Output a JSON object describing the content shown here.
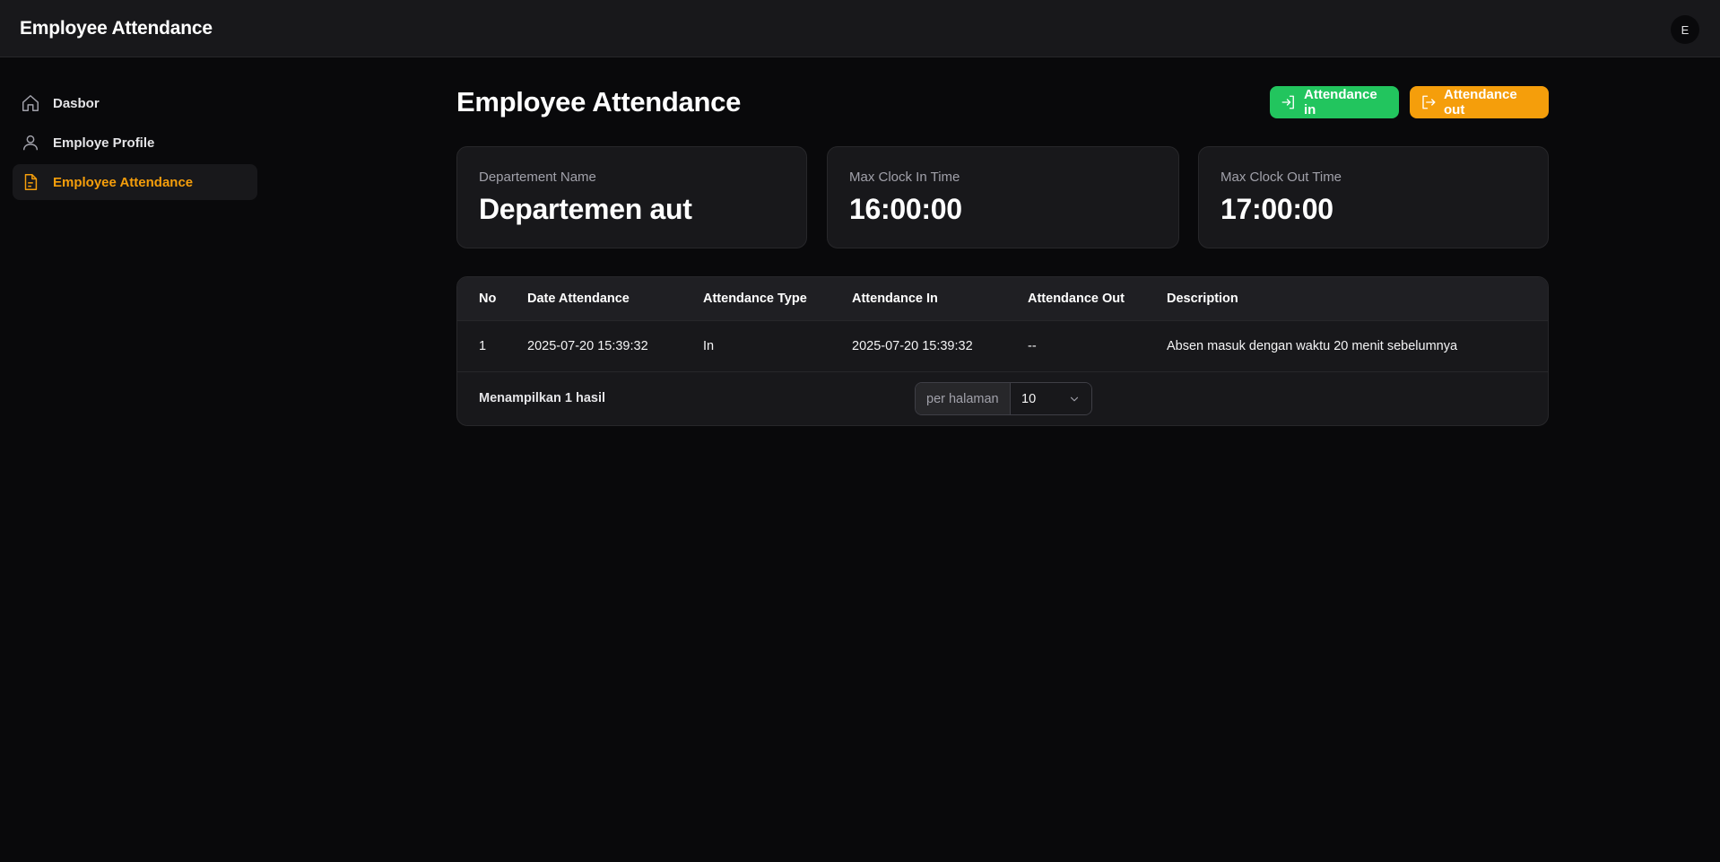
{
  "app": {
    "title": "Employee Attendance",
    "avatar_initial": "E"
  },
  "sidebar": {
    "items": [
      {
        "label": "Dasbor",
        "icon": "home-icon"
      },
      {
        "label": "Employe Profile",
        "icon": "user-icon"
      },
      {
        "label": "Employee Attendance",
        "icon": "document-icon",
        "active": true
      }
    ]
  },
  "header": {
    "title": "Employee Attendance",
    "attendance_in_label": "Attendance in",
    "attendance_out_label": "Attendance out"
  },
  "cards": [
    {
      "label": "Departement Name",
      "value": "Departemen aut"
    },
    {
      "label": "Max Clock In Time",
      "value": "16:00:00"
    },
    {
      "label": "Max Clock Out Time",
      "value": "17:00:00"
    }
  ],
  "table": {
    "columns": [
      "No",
      "Date Attendance",
      "Attendance Type",
      "Attendance In",
      "Attendance Out",
      "Description"
    ],
    "rows": [
      [
        "1",
        "2025-07-20 15:39:32",
        "In",
        "2025-07-20 15:39:32",
        "--",
        "Absen masuk dengan waktu 20 menit sebelumnya"
      ]
    ],
    "result_text": "Menampilkan 1 hasil",
    "per_page_label": "per halaman",
    "per_page_value": "10"
  },
  "colors": {
    "background": "#09090b",
    "surface": "#18181b",
    "accent": "#f59e0b",
    "success": "#22c55e"
  }
}
